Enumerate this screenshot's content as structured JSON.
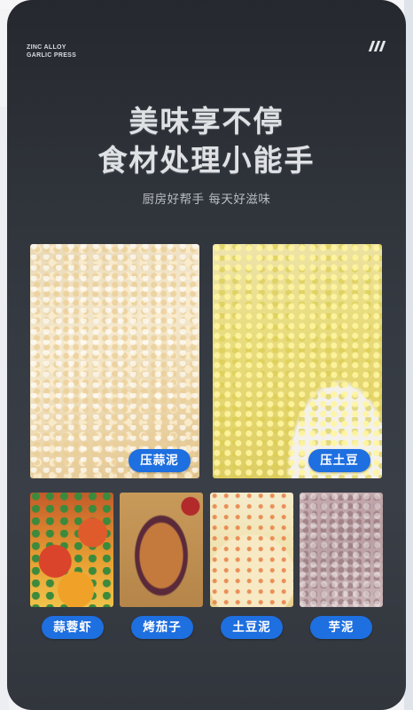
{
  "brand": {
    "line1": "ZINC ALLOY",
    "line2": "GARLIC PRESS"
  },
  "icons": {
    "menu": "triple-slash-menu-icon"
  },
  "headline": {
    "line1": "美味享不停",
    "line2": "食材处理小能手"
  },
  "subtitle": "厨房好帮手 每天好滋味",
  "accent_color": "#1e6fe0",
  "large_items": [
    {
      "label": "压蒜泥",
      "image": "minced-garlic"
    },
    {
      "label": "压土豆",
      "image": "mashed-potato"
    }
  ],
  "small_items": [
    {
      "label": "蒜蓉虾",
      "image": "garlic-shrimp"
    },
    {
      "label": "烤茄子",
      "image": "roasted-eggplant"
    },
    {
      "label": "土豆泥",
      "image": "mashed-potato-dish"
    },
    {
      "label": "芋泥",
      "image": "taro-paste"
    }
  ]
}
